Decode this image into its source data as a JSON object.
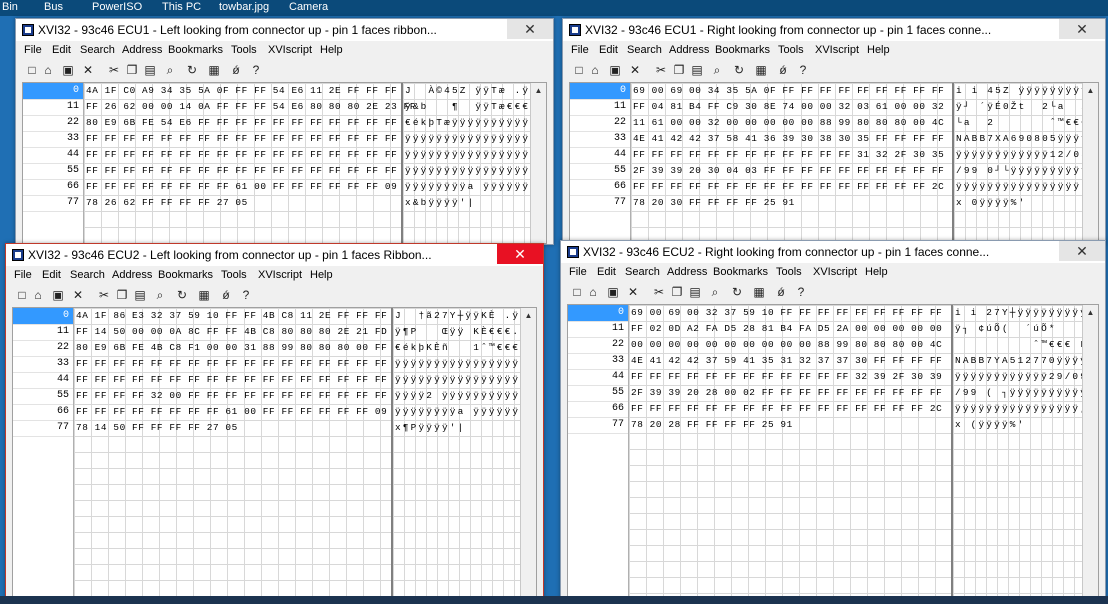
{
  "desktop": {
    "labels": [
      "Bin",
      "Bus",
      "PowerISO",
      "This PC",
      "towbar.jpg",
      "Camera"
    ]
  },
  "menu": [
    "File",
    "Edit",
    "Search",
    "Address",
    "Bookmarks",
    "Tools",
    "XVIscript",
    "Help"
  ],
  "windows": [
    {
      "title": "XVI32 - 93c46 ECU1 - Left looking from connector up - pin 1 faces ribbon...",
      "offsets": [
        "0",
        "11",
        "22",
        "33",
        "44",
        "55",
        "66",
        "77"
      ],
      "hex_rows": [
        "4A 1F C0 A9 34 35 5A 0F FF FF 54 E6 11 2E FF FF FF",
        "FF 26 62 00 00 14 0A FF FF FF 54 E6 80 80 80 2E 23 FF",
        "80 E9 6B FE 54 E6 FF FF FF FF FF FF FF FF FF FF FF",
        "FF FF FF FF FF FF FF FF FF FF FF FF FF FF FF FF FF",
        "FF FF FF FF FF FF FF FF FF FF FF FF FF FF FF FF FF",
        "FF FF FF FF FF FF FF FF FF FF FF FF FF FF FF FF FF",
        "FF FF FF FF FF FF FF FF 61 00 FF FF FF FF FF FF 09",
        "78 26 62 FF FF FF FF 27 05"
      ],
      "text_rows": [
        "J  À©45Z ÿÿTæ .ÿÿÿ",
        "ÿ&b   ¶  ÿÿTæ€€€.#ÿ",
        "€ékþTæÿÿÿÿÿÿÿÿÿÿÿ",
        "ÿÿÿÿÿÿÿÿÿÿÿÿÿÿÿÿÿ",
        "ÿÿÿÿÿÿÿÿÿÿÿÿÿÿÿÿÿ",
        "ÿÿÿÿÿÿÿÿÿÿÿÿÿÿÿÿÿ",
        "ÿÿÿÿÿÿÿÿa ÿÿÿÿÿÿ",
        "x&bÿÿÿÿ'|"
      ]
    },
    {
      "title": "XVI32 - 93c46 ECU1 - Right looking from connector up - pin 1 faces conne...",
      "offsets": [
        "0",
        "11",
        "22",
        "33",
        "44",
        "55",
        "66",
        "77"
      ],
      "hex_rows": [
        "69 00 69 00 34 35 5A 0F FF FF FF FF FF FF FF FF FF",
        "FF 04 81 B4 FF C9 30 8E 74 00 00 32 03 61 00 00 32",
        "11 61 00 00 32 00 00 00 00 00 88 99 80 80 80 00 4C",
        "4E 41 42 42 37 58 41 36 39 30 38 30 35 FF FF FF FF",
        "FF FF FF FF FF FF FF FF FF FF FF FF 31 32 2F 30 35",
        "2F 39 39 20 30 04 03 FF FF FF FF FF FF FF FF FF FF",
        "FF FF FF FF FF FF FF FF FF FF FF FF FF FF FF FF 2C",
        "78 20 30 FF FF FF FF 25 91"
      ],
      "text_rows": [
        "i i 45Z ÿÿÿÿÿÿÿÿÿ",
        "ÿ┘ ´ÿÉ0Žt  2└a  2",
        "└a  2       ˆ™€€€ L",
        "NABB7XA690805ÿÿÿÿ",
        "ÿÿÿÿÿÿÿÿÿÿÿÿ12/05",
        "/99 0┘└ÿÿÿÿÿÿÿÿÿÿ",
        "ÿÿÿÿÿÿÿÿÿÿÿÿÿÿÿÿ,",
        "x 0ÿÿÿÿ%'"
      ]
    },
    {
      "title": "XVI32 - 93c46 ECU2 - Left looking from connector up - pin 1 faces Ribbon...",
      "offsets": [
        "0",
        "11",
        "22",
        "33",
        "44",
        "55",
        "66",
        "77"
      ],
      "hex_rows": [
        "4A 1F 86 E3 32 37 59 10 FF FF 4B C8 11 2E FF FF FF",
        "FF 14 50 00 00 0A 8C FF FF 4B C8 80 80 80 2E 21 FD",
        "80 E9 6B FE 4B C8 F1 00 00 31 88 99 80 80 80 00 FF",
        "FF FF FF FF FF FF FF FF FF FF FF FF FF FF FF FF FF",
        "FF FF FF FF FF FF FF FF FF FF FF FF FF FF FF FF FF",
        "FF FF FF FF 32 00 FF FF FF FF FF FF FF FF FF FF FF",
        "FF FF FF FF FF FF FF FF 61 00 FF FF FF FF FF FF 09",
        "78 14 50 FF FF FF FF 27 05"
      ],
      "text_rows": [
        "J  †ã27Y┼ÿÿKÈ .ÿÿÿ",
        "ÿ¶P   Œÿÿ KÈ€€€.!ý",
        "€ékþKÈñ   1ˆ™€€€ ÿ",
        "ÿÿÿÿÿÿÿÿÿÿÿÿÿÿÿÿÿ",
        "ÿÿÿÿÿÿÿÿÿÿÿÿÿÿÿÿÿ",
        "ÿÿÿÿ2 ÿÿÿÿÿÿÿÿÿÿÿ",
        "ÿÿÿÿÿÿÿÿa ÿÿÿÿÿÿ",
        "x¶Pÿÿÿÿ'|"
      ]
    },
    {
      "title": "XVI32 - 93c46 ECU2 - Right looking from connector up - pin 1 faces conne...",
      "offsets": [
        "0",
        "11",
        "22",
        "33",
        "44",
        "55",
        "66",
        "77"
      ],
      "hex_rows": [
        "69 00 69 00 32 37 59 10 FF FF FF FF FF FF FF FF FF",
        "FF 02 0D A2 FA D5 28 81 B4 FA D5 2A 00 00 00 00 00",
        "00 00 00 00 00 00 00 00 00 00 88 99 80 80 80 00 4C",
        "4E 41 42 42 37 59 41 35 31 32 37 37 30 FF FF FF FF",
        "FF FF FF FF FF FF FF FF FF FF FF FF 32 39 2F 30 39",
        "2F 39 39 20 28 00 02 FF FF FF FF FF FF FF FF FF FF",
        "FF FF FF FF FF FF FF FF FF FF FF FF FF FF FF FF 2C",
        "78 20 28 FF FF FF FF 25 91"
      ],
      "text_rows": [
        "i i 27Y┼ÿÿÿÿÿÿÿÿÿ",
        "ÿ┐ ¢úÕ(  ´úÕ*",
        "          ˆ™€€€ L",
        "NABB7YA512770ÿÿÿÿ",
        "ÿÿÿÿÿÿÿÿÿÿÿÿ29/09",
        "/99 ( ┐ÿÿÿÿÿÿÿÿÿÿ",
        "ÿÿÿÿÿÿÿÿÿÿÿÿÿÿÿÿ,",
        "x (ÿÿÿÿ%'"
      ]
    }
  ]
}
